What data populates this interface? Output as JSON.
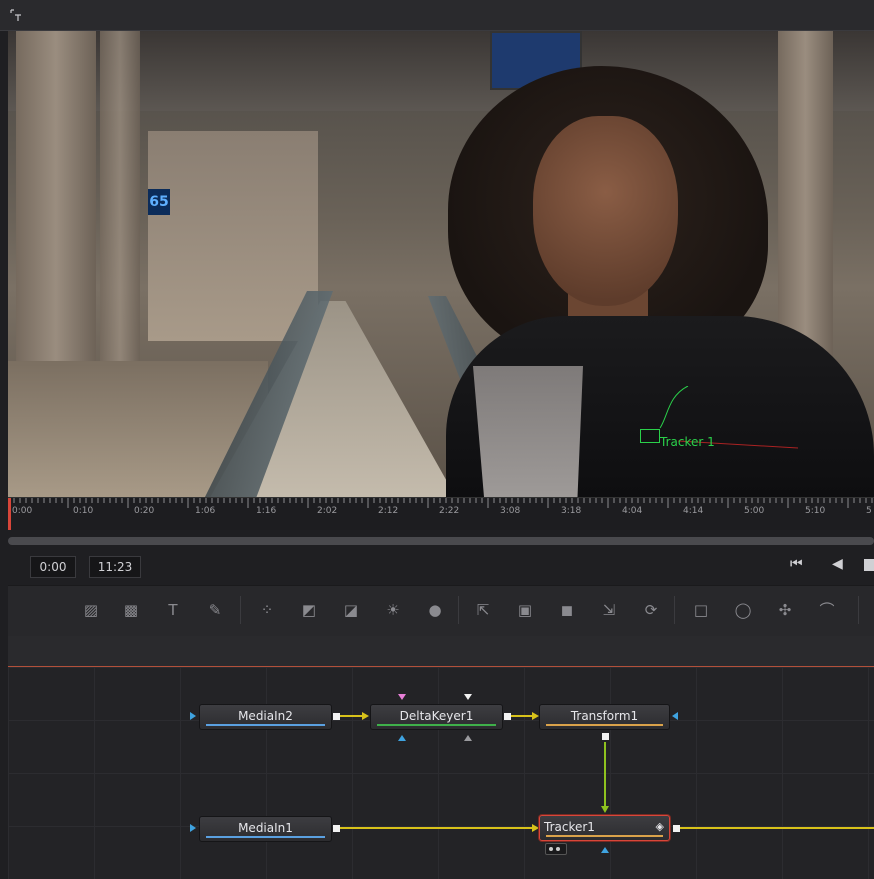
{
  "viewer": {
    "tracker_label": "Tracker 1",
    "screen_number": "65"
  },
  "ruler": {
    "marks": [
      "0:00",
      "0:10",
      "0:20",
      "1:06",
      "1:16",
      "2:02",
      "2:12",
      "2:22",
      "3:08",
      "3:18",
      "4:04",
      "4:14",
      "5:00",
      "5:10",
      "5"
    ]
  },
  "transport": {
    "current_time": "0:00",
    "end_time": "11:23",
    "skip_back_icon": "skip-to-start-icon",
    "play_reverse_icon": "play-reverse-icon",
    "stop_icon": "stop-icon"
  },
  "toolbar": {
    "tools": [
      {
        "name": "background-tool-icon",
        "glyph": "▨"
      },
      {
        "name": "fastnoise-tool-icon",
        "glyph": "▩"
      },
      {
        "name": "text-tool-icon",
        "glyph": "T"
      },
      {
        "name": "paint-tool-icon",
        "glyph": "✎"
      },
      {
        "name": "particles-tool-icon",
        "glyph": "⁘"
      },
      {
        "name": "color-curves-icon",
        "glyph": "◩"
      },
      {
        "name": "color-corrector-icon",
        "glyph": "◪"
      },
      {
        "name": "brightness-contrast-icon",
        "glyph": "☀"
      },
      {
        "name": "blur-icon",
        "glyph": "●"
      },
      {
        "name": "loader-icon",
        "glyph": "⇱"
      },
      {
        "name": "merge-icon",
        "glyph": "▣"
      },
      {
        "name": "matte-control-icon",
        "glyph": "◼"
      },
      {
        "name": "resize-icon",
        "glyph": "⇲"
      },
      {
        "name": "transform-tool-icon",
        "glyph": "⟳"
      },
      {
        "name": "rectangle-mask-icon",
        "glyph": "□"
      },
      {
        "name": "ellipse-mask-icon",
        "glyph": "◯"
      },
      {
        "name": "polygon-mask-icon",
        "glyph": "✣"
      },
      {
        "name": "bspline-mask-icon",
        "glyph": "⌒"
      }
    ]
  },
  "nodes": {
    "mediain2": "MediaIn2",
    "deltakeyer1": "DeltaKeyer1",
    "transform1": "Transform1",
    "mediain1": "MediaIn1",
    "tracker1": "Tracker1"
  },
  "colors": {
    "media_strip": "#5aa0e0",
    "keyer_strip": "#3fb04a",
    "transform_strip": "#d9a24a",
    "tracker_strip": "#d9a24a",
    "wire_yellow": "#d8c21a",
    "wire_green": "#8fc21f",
    "accent_red": "#d8463a"
  }
}
